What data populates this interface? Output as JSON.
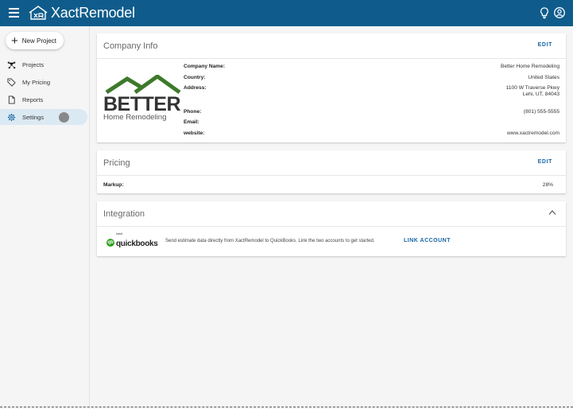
{
  "app": {
    "name": "XactRemodel"
  },
  "sidebar": {
    "new_project_label": "New Project",
    "items": [
      {
        "label": "Projects",
        "icon": "projects-icon"
      },
      {
        "label": "My Pricing",
        "icon": "tag-icon"
      },
      {
        "label": "Reports",
        "icon": "report-icon"
      },
      {
        "label": "Settings",
        "icon": "gear-icon",
        "active": true
      }
    ]
  },
  "company_info": {
    "title": "Company Info",
    "edit_label": "EDIT",
    "logo": {
      "word": "BETTER",
      "sub": "Home Remodeling"
    },
    "fields": {
      "company_name": {
        "label": "Company Name:",
        "value": "Better Home Remodeling"
      },
      "country": {
        "label": "Country:",
        "value": "United States"
      },
      "address": {
        "label": "Address:",
        "line1": "1100 W Traverse Pkwy",
        "line2": "Lehi, UT, 84043"
      },
      "phone": {
        "label": "Phone:",
        "value": "(801) 555-5555"
      },
      "email": {
        "label": "Email:",
        "value": ""
      },
      "website": {
        "label": "website:",
        "value": "www.xactremodel.com"
      }
    }
  },
  "pricing": {
    "title": "Pricing",
    "edit_label": "EDIT",
    "markup_label": "Markup:",
    "markup_value": "28%"
  },
  "integration": {
    "title": "Integration",
    "qb_circle": "qb",
    "qb_intuit": "intuit",
    "qb_word": "quickbooks",
    "description": "Send estimate data directly from XactRemodel to QuickBooks. Link the two accounts to get started.",
    "link_label": "LINK ACCOUNT"
  },
  "colors": {
    "header": "#0f5c8c",
    "accent": "#1565a5",
    "active_nav": "#dbe9f3",
    "brand_green": "#3d7a2a",
    "qb_green": "#2ca01c"
  }
}
